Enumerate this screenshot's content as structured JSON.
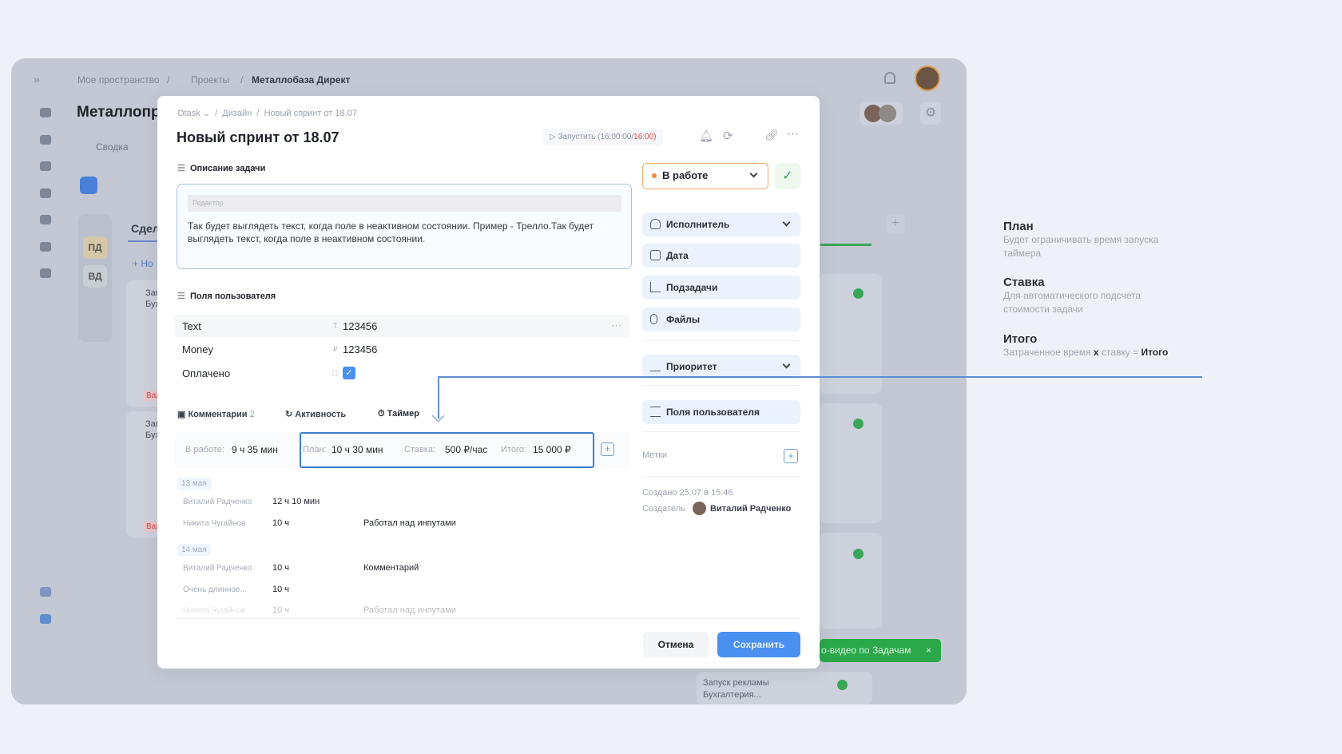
{
  "app": {
    "breadcrumb": [
      "Мое пространство",
      "Проекты",
      "Металлобаза Директ"
    ],
    "page_title": "Металлопр",
    "tab_summary": "Сводка",
    "column_initials": [
      "ПД",
      "ВД"
    ],
    "column_title": "Сдел",
    "new_label": "+ Но",
    "card_title_1": "Запус",
    "card_title_2": "Бухга",
    "card_badge": "Важ",
    "toast": "о-видео по Задачам",
    "bottom_card_title": "Запуск рекламы",
    "bottom_card_sub": "Бухгалтерия..."
  },
  "modal": {
    "breadcrumb": [
      "Otask",
      "Дизайн",
      "Новый спринт от 18.07"
    ],
    "title": "Новый спринт от 18.07",
    "timer_button": "Запустить (16:00:00/",
    "timer_limit": "16:00)",
    "description_label": "Описание задачи",
    "editor_placeholder": "Редактор",
    "description_text": "Так будет выглядеть текст, когда поле в неактивном состоянии. Пример - Трелло.Так будет выглядеть текст, когда поле в неактивном состоянии.",
    "custom_fields_label": "Поля пользователя",
    "fields": [
      {
        "name": "Text",
        "type_icon": "T",
        "value": "123456"
      },
      {
        "name": "Money",
        "type_icon": "₽",
        "value": "123456"
      },
      {
        "name": "Оплачено",
        "type_icon": "☐",
        "value": "",
        "checked": true
      }
    ],
    "tabs": [
      {
        "label": "Комментарии",
        "count": "2"
      },
      {
        "label": "Активность"
      },
      {
        "label": "Таймер"
      }
    ],
    "timer": {
      "in_work_label": "В работе:",
      "in_work_value": "9 ч 35 мин",
      "plan_label": "План:",
      "plan_value": "10 ч 30 мин",
      "rate_label": "Ставка:",
      "rate_value": "500 ₽/час",
      "total_label": "Итого:",
      "total_value": "15 000 ₽"
    },
    "log": [
      {
        "date": "13 мая",
        "entries": [
          {
            "user": "Виталий Радченко",
            "time": "12 ч 10 мин",
            "comment": ""
          },
          {
            "user": "Никита Чугайнов",
            "time": "10 ч",
            "comment": "Работал над инпутами"
          }
        ]
      },
      {
        "date": "14 мая",
        "entries": [
          {
            "user": "Виталий Радченко",
            "time": "10 ч",
            "comment": "Комментарий"
          },
          {
            "user": "Очень длинное...",
            "time": "10 ч",
            "comment": ""
          },
          {
            "user": "Никита Чугайнов",
            "time": "10 ч",
            "comment": "Работал над инпутами"
          }
        ]
      }
    ],
    "status": "В работе",
    "status_color": "#f08a3c",
    "side": [
      "Исполнитель",
      "Дата",
      "Подзадачи",
      "Файлы",
      "Приоритет",
      "Поля пользователя"
    ],
    "tags_label": "Метки",
    "created": "Создано 25.07 в 15:46",
    "creator_label": "Создатель",
    "creator": "Виталий Радченко",
    "cancel": "Отмена",
    "save": "Сохранить"
  },
  "annotations": [
    {
      "title": "План",
      "text": "Будет ограничивать время запуска",
      "text2": "таймера"
    },
    {
      "title": "Ставка",
      "text": "Для автоматического подсчета",
      "text2": "стоимости задачи"
    },
    {
      "title": "Итого",
      "text": "Затраченное время",
      "x": "x",
      "text_mid": "ставку =",
      "bold_end": "Итого"
    }
  ],
  "colors": {
    "accent": "#4a90f0",
    "success": "#2aa84a",
    "highlight": "#3a7fd0"
  }
}
